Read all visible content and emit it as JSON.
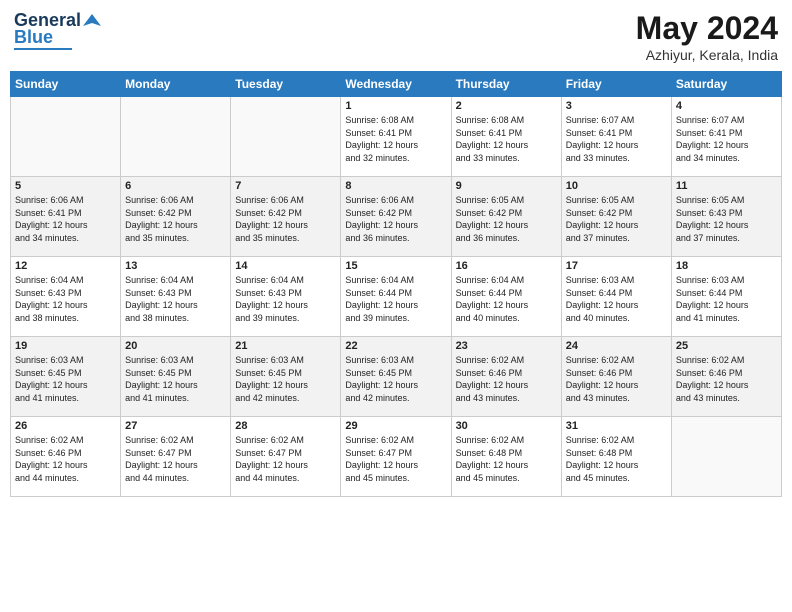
{
  "header": {
    "logo_general": "General",
    "logo_blue": "Blue",
    "month": "May 2024",
    "location": "Azhiyur, Kerala, India"
  },
  "weekdays": [
    "Sunday",
    "Monday",
    "Tuesday",
    "Wednesday",
    "Thursday",
    "Friday",
    "Saturday"
  ],
  "weeks": [
    [
      {
        "day": "",
        "info": ""
      },
      {
        "day": "",
        "info": ""
      },
      {
        "day": "",
        "info": ""
      },
      {
        "day": "1",
        "info": "Sunrise: 6:08 AM\nSunset: 6:41 PM\nDaylight: 12 hours\nand 32 minutes."
      },
      {
        "day": "2",
        "info": "Sunrise: 6:08 AM\nSunset: 6:41 PM\nDaylight: 12 hours\nand 33 minutes."
      },
      {
        "day": "3",
        "info": "Sunrise: 6:07 AM\nSunset: 6:41 PM\nDaylight: 12 hours\nand 33 minutes."
      },
      {
        "day": "4",
        "info": "Sunrise: 6:07 AM\nSunset: 6:41 PM\nDaylight: 12 hours\nand 34 minutes."
      }
    ],
    [
      {
        "day": "5",
        "info": "Sunrise: 6:06 AM\nSunset: 6:41 PM\nDaylight: 12 hours\nand 34 minutes."
      },
      {
        "day": "6",
        "info": "Sunrise: 6:06 AM\nSunset: 6:42 PM\nDaylight: 12 hours\nand 35 minutes."
      },
      {
        "day": "7",
        "info": "Sunrise: 6:06 AM\nSunset: 6:42 PM\nDaylight: 12 hours\nand 35 minutes."
      },
      {
        "day": "8",
        "info": "Sunrise: 6:06 AM\nSunset: 6:42 PM\nDaylight: 12 hours\nand 36 minutes."
      },
      {
        "day": "9",
        "info": "Sunrise: 6:05 AM\nSunset: 6:42 PM\nDaylight: 12 hours\nand 36 minutes."
      },
      {
        "day": "10",
        "info": "Sunrise: 6:05 AM\nSunset: 6:42 PM\nDaylight: 12 hours\nand 37 minutes."
      },
      {
        "day": "11",
        "info": "Sunrise: 6:05 AM\nSunset: 6:43 PM\nDaylight: 12 hours\nand 37 minutes."
      }
    ],
    [
      {
        "day": "12",
        "info": "Sunrise: 6:04 AM\nSunset: 6:43 PM\nDaylight: 12 hours\nand 38 minutes."
      },
      {
        "day": "13",
        "info": "Sunrise: 6:04 AM\nSunset: 6:43 PM\nDaylight: 12 hours\nand 38 minutes."
      },
      {
        "day": "14",
        "info": "Sunrise: 6:04 AM\nSunset: 6:43 PM\nDaylight: 12 hours\nand 39 minutes."
      },
      {
        "day": "15",
        "info": "Sunrise: 6:04 AM\nSunset: 6:44 PM\nDaylight: 12 hours\nand 39 minutes."
      },
      {
        "day": "16",
        "info": "Sunrise: 6:04 AM\nSunset: 6:44 PM\nDaylight: 12 hours\nand 40 minutes."
      },
      {
        "day": "17",
        "info": "Sunrise: 6:03 AM\nSunset: 6:44 PM\nDaylight: 12 hours\nand 40 minutes."
      },
      {
        "day": "18",
        "info": "Sunrise: 6:03 AM\nSunset: 6:44 PM\nDaylight: 12 hours\nand 41 minutes."
      }
    ],
    [
      {
        "day": "19",
        "info": "Sunrise: 6:03 AM\nSunset: 6:45 PM\nDaylight: 12 hours\nand 41 minutes."
      },
      {
        "day": "20",
        "info": "Sunrise: 6:03 AM\nSunset: 6:45 PM\nDaylight: 12 hours\nand 41 minutes."
      },
      {
        "day": "21",
        "info": "Sunrise: 6:03 AM\nSunset: 6:45 PM\nDaylight: 12 hours\nand 42 minutes."
      },
      {
        "day": "22",
        "info": "Sunrise: 6:03 AM\nSunset: 6:45 PM\nDaylight: 12 hours\nand 42 minutes."
      },
      {
        "day": "23",
        "info": "Sunrise: 6:02 AM\nSunset: 6:46 PM\nDaylight: 12 hours\nand 43 minutes."
      },
      {
        "day": "24",
        "info": "Sunrise: 6:02 AM\nSunset: 6:46 PM\nDaylight: 12 hours\nand 43 minutes."
      },
      {
        "day": "25",
        "info": "Sunrise: 6:02 AM\nSunset: 6:46 PM\nDaylight: 12 hours\nand 43 minutes."
      }
    ],
    [
      {
        "day": "26",
        "info": "Sunrise: 6:02 AM\nSunset: 6:46 PM\nDaylight: 12 hours\nand 44 minutes."
      },
      {
        "day": "27",
        "info": "Sunrise: 6:02 AM\nSunset: 6:47 PM\nDaylight: 12 hours\nand 44 minutes."
      },
      {
        "day": "28",
        "info": "Sunrise: 6:02 AM\nSunset: 6:47 PM\nDaylight: 12 hours\nand 44 minutes."
      },
      {
        "day": "29",
        "info": "Sunrise: 6:02 AM\nSunset: 6:47 PM\nDaylight: 12 hours\nand 45 minutes."
      },
      {
        "day": "30",
        "info": "Sunrise: 6:02 AM\nSunset: 6:48 PM\nDaylight: 12 hours\nand 45 minutes."
      },
      {
        "day": "31",
        "info": "Sunrise: 6:02 AM\nSunset: 6:48 PM\nDaylight: 12 hours\nand 45 minutes."
      },
      {
        "day": "",
        "info": ""
      }
    ]
  ]
}
